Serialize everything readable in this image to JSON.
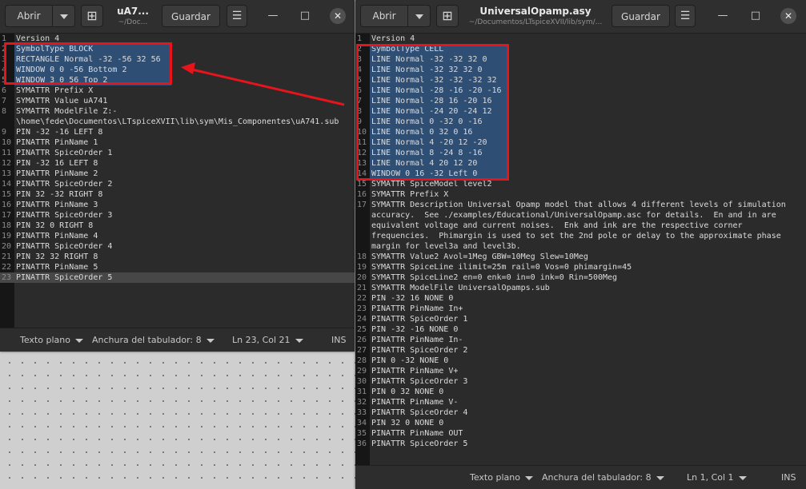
{
  "left": {
    "open_label": "Abrir",
    "title": "uA7...",
    "subtitle": "~/Doc...",
    "save_label": "Guardar",
    "lines": [
      "Version 4",
      "SymbolType BLOCK",
      "RECTANGLE Normal -32 -56 32 56",
      "WINDOW 0 0 -56 Bottom 2",
      "WINDOW 3 0 56 Top 2",
      "SYMATTR Prefix X",
      "SYMATTR Value uA741",
      "SYMATTR ModelFile Z:-",
      "\\home\\fede\\Documentos\\LTspiceXVII\\lib\\sym\\Mis_Componentes\\uA741.sub",
      "PIN -32 -16 LEFT 8",
      "PINATTR PinName 1",
      "PINATTR SpiceOrder 1",
      "PIN -32 16 LEFT 8",
      "PINATTR PinName 2",
      "PINATTR SpiceOrder 2",
      "PIN 32 -32 RIGHT 8",
      "PINATTR PinName 3",
      "PINATTR SpiceOrder 3",
      "PIN 32 0 RIGHT 8",
      "PINATTR PinName 4",
      "PINATTR SpiceOrder 4",
      "PIN 32 32 RIGHT 8",
      "PINATTR PinName 5",
      "PINATTR SpiceOrder 5"
    ],
    "line_numbers": [
      "1",
      "2",
      "3",
      "4",
      "5",
      "6",
      "7",
      "8",
      "",
      "9",
      "10",
      "11",
      "12",
      "13",
      "14",
      "15",
      "16",
      "17",
      "18",
      "19",
      "20",
      "21",
      "22",
      "23"
    ],
    "status": {
      "syntax": "Texto plano",
      "tab_width": "Anchura del tabulador: 8",
      "position": "Ln 23, Col 21",
      "mode": "INS"
    }
  },
  "right": {
    "open_label": "Abrir",
    "title": "UniversalOpamp.asy",
    "subtitle": "~/Documentos/LTspiceXVII/lib/sym/...",
    "save_label": "Guardar",
    "lines": [
      "Version 4",
      "SymbolType CELL",
      "LINE Normal -32 -32 32 0",
      "LINE Normal -32 32 32 0",
      "LINE Normal -32 -32 -32 32",
      "LINE Normal -28 -16 -20 -16",
      "LINE Normal -28 16 -20 16",
      "LINE Normal -24 20 -24 12",
      "LINE Normal 0 -32 0 -16",
      "LINE Normal 0 32 0 16",
      "LINE Normal 4 -20 12 -20",
      "LINE Normal 8 -24 8 -16",
      "LINE Normal 4 20 12 20",
      "WINDOW 0 16 -32 Left 0",
      "SYMATTR SpiceModel level2",
      "SYMATTR Prefix X",
      "SYMATTR Description Universal Opamp model that allows 4 different levels of simulation",
      "accuracy.  See ./examples/Educational/UniversalOpamp.asc for details.  En and in are",
      "equivalent voltage and current noises.  Enk and ink are the respective corner",
      "frequencies.  Phimargin is used to set the 2nd pole or delay to the approximate phase",
      "margin for level3a and level3b.",
      "SYMATTR Value2 Avol=1Meg GBW=10Meg Slew=10Meg",
      "SYMATTR SpiceLine ilimit=25m rail=0 Vos=0 phimargin=45",
      "SYMATTR SpiceLine2 en=0 enk=0 in=0 ink=0 Rin=500Meg",
      "SYMATTR ModelFile UniversalOpamps.sub",
      "PIN -32 16 NONE 0",
      "PINATTR PinName In+",
      "PINATTR SpiceOrder 1",
      "PIN -32 -16 NONE 0",
      "PINATTR PinName In-",
      "PINATTR SpiceOrder 2",
      "PIN 0 -32 NONE 0",
      "PINATTR PinName V+",
      "PINATTR SpiceOrder 3",
      "PIN 0 32 NONE 0",
      "PINATTR PinName V-",
      "PINATTR SpiceOrder 4",
      "PIN 32 0 NONE 0",
      "PINATTR PinName OUT",
      "PINATTR SpiceOrder 5"
    ],
    "line_numbers": [
      "1",
      "2",
      "3",
      "4",
      "5",
      "6",
      "7",
      "8",
      "9",
      "10",
      "11",
      "12",
      "13",
      "14",
      "15",
      "16",
      "17",
      "",
      "",
      "",
      "",
      "18",
      "19",
      "20",
      "21",
      "22",
      "23",
      "24",
      "25",
      "26",
      "27",
      "28",
      "29",
      "30",
      "31",
      "32",
      "33",
      "34",
      "35",
      "36"
    ],
    "status": {
      "syntax": "Texto plano",
      "tab_width": "Anchura del tabulador: 8",
      "position": "Ln 1, Col 1",
      "mode": "INS"
    }
  },
  "colors": {
    "highlight_box": "#e8141c",
    "selection": "#2f4e73",
    "editor_bg": "#2b2b2b"
  }
}
